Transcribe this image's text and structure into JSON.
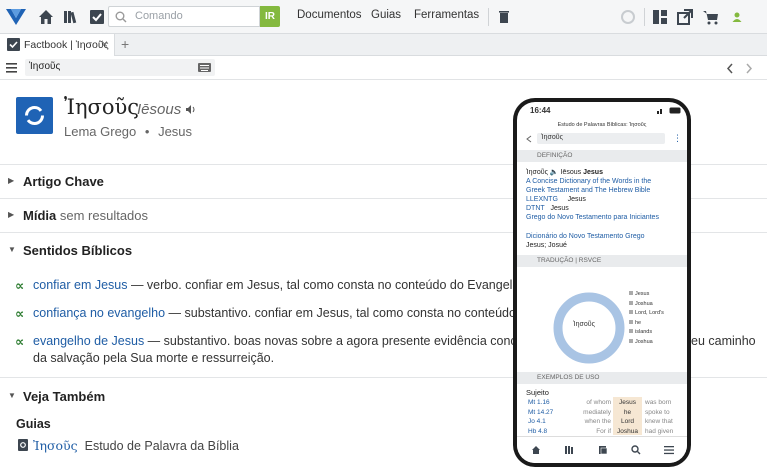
{
  "toolbar": {
    "search_placeholder": "Comando",
    "go_label": "IR",
    "menu": [
      "Documentos",
      "Guias",
      "Ferramentas"
    ]
  },
  "tab": {
    "label": "Factbook | Ἰησοῦς"
  },
  "address": {
    "value": "Ἰησοῦς"
  },
  "entry": {
    "word": "Ἰησοῦς",
    "transliteration": "Iēsous",
    "lemma_label": "Lema Grego",
    "gloss": "Jesus",
    "bullet": "•"
  },
  "sections": {
    "key_article": "Artigo Chave",
    "media": "Mídia",
    "media_note": "sem resultados",
    "biblical_senses": "Sentidos Bíblicos",
    "see_also": "Veja Também",
    "guides": "Guias"
  },
  "senses": [
    {
      "link": "confiar em Jesus",
      "text": " — verbo. confiar em Jesus, tal como consta no conteúdo do Evangelho."
    },
    {
      "link": "confiança no evangelho",
      "text": " — substantivo. confiar em Jesus, tal como consta no conteúdo d"
    },
    {
      "link": "evangelho de Jesus",
      "text": " — substantivo. boas novas sobre a agora presente evidência concret",
      "text_right": "eu caminho",
      "line2": "da salvação pela Sua morte e ressurreição."
    }
  ],
  "guide": {
    "word": "Ἰησοῦς",
    "label": "Estudo de Palavra da Bíblia"
  },
  "phone": {
    "time": "16:44",
    "title": "Estudo de Palavras Bíblicas: Ἰησοῦς",
    "address": "Ἰησοῦς",
    "sec_definition": "DEFINIÇÃO",
    "def_word": "Ἰησοῦς",
    "def_translit": "Iēsous",
    "def_gloss": "Jesus",
    "def_lines": [
      "A Concise Dictionary of the Words in the",
      "Greek Testament and The Hebrew Bible"
    ],
    "lexicons": [
      {
        "abbr": "LLEXNTG",
        "gloss": "Jesus"
      },
      {
        "abbr": "DTNT",
        "gloss": "Jesus"
      }
    ],
    "link3": "Grego do Novo Testamento para Iniciantes",
    "link4": "Dicionário do Novo Testamento Grego",
    "link4_gloss": "Jesus; Josué",
    "sec_translation": "TRADUÇÃO | RSVCE",
    "donut_center": "Ἰησοῦς",
    "legend": [
      "Jesus",
      "Joshua",
      "Lord, Lord's",
      "he",
      "islands",
      "Joshua"
    ],
    "sec_examples": "EXEMPLOS DE USO",
    "examples_label": "Sujeito",
    "examples": [
      {
        "ref": "Mt 1.16",
        "left": "of whom",
        "mid": "Jesus",
        "right": "was born"
      },
      {
        "ref": "Mt 14.27",
        "left": "mediately",
        "mid": "he",
        "right": "spoke to"
      },
      {
        "ref": "Jo 4.1",
        "left": "when the",
        "mid": "Lord",
        "right": "knew that"
      },
      {
        "ref": "Hb 4.8",
        "left": "For if",
        "mid": "Joshua",
        "right": "had given"
      }
    ]
  },
  "colors": {
    "accent": "#1f63b5",
    "go": "#84b93f",
    "link": "#1f5da5",
    "sense_icon": "#2e7d32",
    "donut": "#a9c4e4"
  }
}
